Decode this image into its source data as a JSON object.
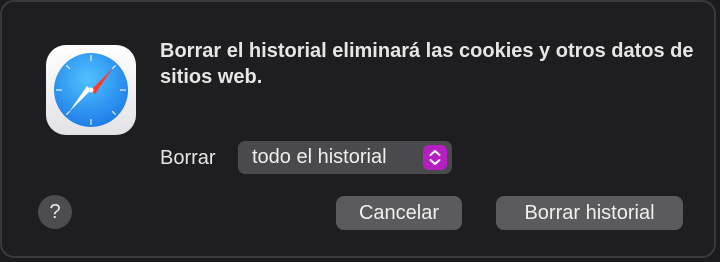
{
  "app_icon": {
    "name": "safari-compass-icon"
  },
  "dialog": {
    "message": "Borrar el historial eliminará las cookies y otros datos de sitios web.",
    "clear_label": "Borrar",
    "range_select": {
      "value": "todo el historial"
    },
    "help_label": "?",
    "cancel_label": "Cancelar",
    "confirm_label": "Borrar historial"
  },
  "colors": {
    "background": "#1e1e20",
    "button": "#5b5b5e",
    "select_accent": "#b51fc1",
    "text": "#e6e6e6"
  }
}
